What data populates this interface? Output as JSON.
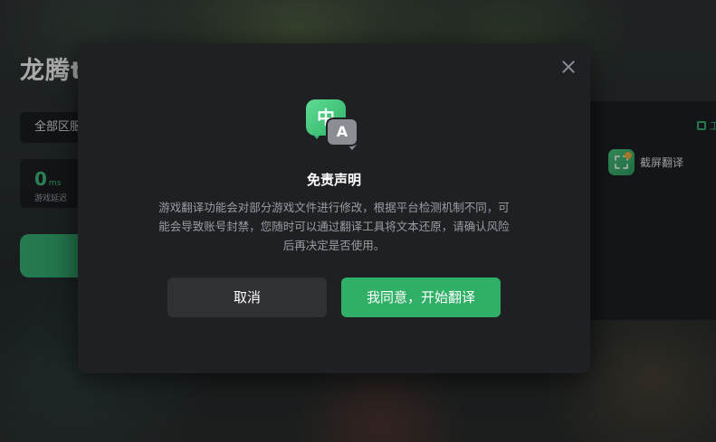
{
  "background": {
    "app_title": "龙腾t",
    "region_select": "全部区服",
    "latency": {
      "value": "0",
      "unit": "ms",
      "label": "游戏延迟"
    }
  },
  "tools": {
    "header_label": "工",
    "screenshot_translate": {
      "label": "截屏翻译",
      "icon": "screenshot-translate-icon"
    }
  },
  "modal": {
    "icon": {
      "zh_char": "中",
      "en_char": "A"
    },
    "title": "免责声明",
    "body": "游戏翻译功能会对部分游戏文件进行修改，根据平台检测机制不同，可能会导致账号封禁，您随时可以通过翻译工具将文本还原，请确认风险后再决定是否使用。",
    "cancel_label": "取消",
    "agree_label": "我同意，开始翻译",
    "colors": {
      "accent": "#2fb066",
      "modal_bg": "#1f2023",
      "cancel_bg": "#303135"
    }
  }
}
